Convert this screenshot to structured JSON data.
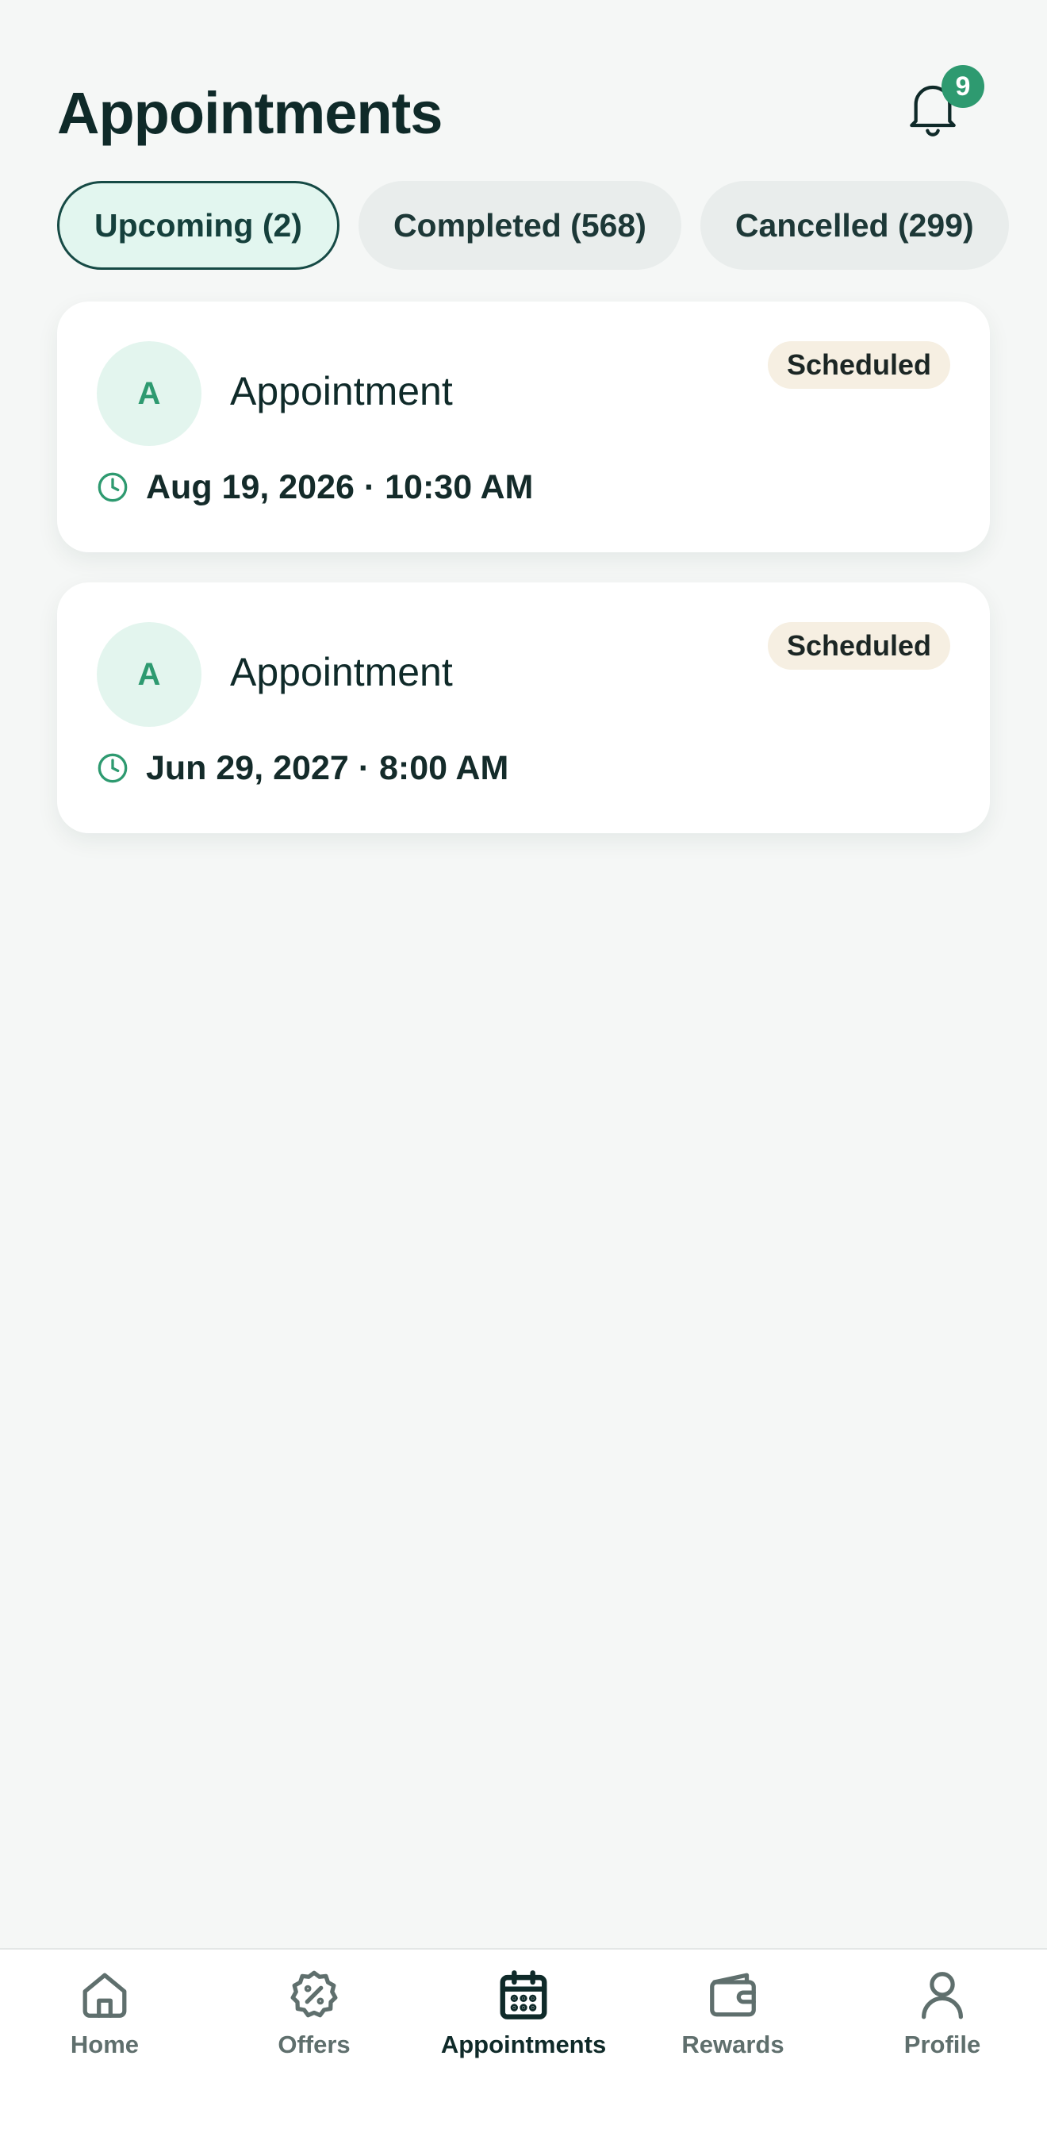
{
  "header": {
    "title": "Appointments",
    "notification_count": "9"
  },
  "tabs": [
    {
      "label": "Upcoming (2)",
      "active": true
    },
    {
      "label": "Completed (568)",
      "active": false
    },
    {
      "label": "Cancelled (299)",
      "active": false
    }
  ],
  "appointments": [
    {
      "avatar_letter": "A",
      "title": "Appointment",
      "status": "Scheduled",
      "datetime": "Aug 19, 2026 · 10:30 AM"
    },
    {
      "avatar_letter": "A",
      "title": "Appointment",
      "status": "Scheduled",
      "datetime": "Jun 29, 2027 · 8:00 AM"
    }
  ],
  "bottom_nav": [
    {
      "label": "Home",
      "icon": "home-icon",
      "active": false
    },
    {
      "label": "Offers",
      "icon": "offer-badge-icon",
      "active": false
    },
    {
      "label": "Appointments",
      "icon": "calendar-icon",
      "active": true
    },
    {
      "label": "Rewards",
      "icon": "wallet-icon",
      "active": false
    },
    {
      "label": "Profile",
      "icon": "user-icon",
      "active": false
    }
  ],
  "colors": {
    "accent": "#2e9a70",
    "dark_text": "#0f2a29",
    "background": "#f5f7f6",
    "badge_background": "#f6efe2",
    "active_tab_background": "#e2f6ef"
  }
}
